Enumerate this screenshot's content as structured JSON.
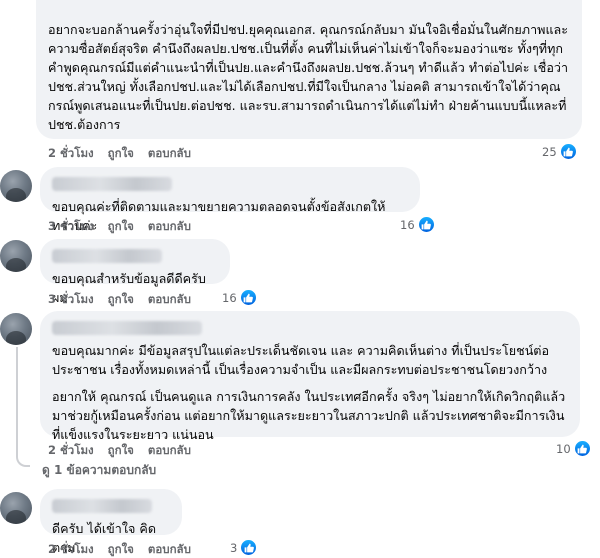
{
  "comments": [
    {
      "paragraphs": [
        "อยากจะบอกล้านครั้งว่าอุ่นใจที่มีปชป.ยุคคุณเอกส. คุณกรณ์กลับมา มันใจอิเชื่อมั่นในศักยภาพและความซื่อสัตย์สุจริต คำนึงถึงผลปย.ปชช.เป็นที่ตั้ง คนที่ไม่เห็นค่าไม่เข้าใจก็จะมองว่าแซะ ทั้งๆที่ทุกคำพูดคุณกรณ์มีแต่คำแนะนำที่เป็นปย.และคำนึงถึงผลปย.ปชช.ล้วนๆ ทำดีแล้ว ทำต่อไปค่ะ เชื่อว่าปชช.ส่วนใหญ่ ทั้งเลือกปชป.และไม่ได้เลือกปชป.ที่มีใจเป็นกลาง ไม่อคติ สามารถเข้าใจได้ว่าคุณกรณ์พูดเสนอแนะที่เป็นปย.ต่อปชช. และรบ.สามารถดำเนินการได้แต่ไม่ทำ ฝ่ายค้านแบบนี้แหละที่ปชช.ต้องการ"
      ],
      "time": "2 ชั่วโมง",
      "like_label": "ถูกใจ",
      "reply_label": "ตอบกลับ",
      "reaction_count": "25"
    },
    {
      "paragraphs": [
        "ขอบคุณค่ะที่ติดตามและมาขยายความตลอดจนตั้งข้อสังเกตให้ทราบค่ะ"
      ],
      "time": "3 ชั่วโมง",
      "like_label": "ถูกใจ",
      "reply_label": "ตอบกลับ",
      "reaction_count": "16"
    },
    {
      "paragraphs": [
        "ขอบคุณสำหรับข้อมูลดีดีครับผม"
      ],
      "time": "3 ชั่วโมง",
      "like_label": "ถูกใจ",
      "reply_label": "ตอบกลับ",
      "reaction_count": "16"
    },
    {
      "paragraphs": [
        "ขอบคุณมากค่ะ มีข้อมูลสรุปในแต่ละประเด็นชัดเจน และ ความคิดเห็นต่าง ที่เป็นประโยชน์ต่อประชาชน เรื่องทั้งหมดเหล่านี้ เป็นเรื่องความจำเป็น และมีผลกระทบต่อประชาชนโดยวงกว้าง",
        "อยากให้ คุณกรณ์ เป็นคนดูแล การเงินการคลัง ในประเทศอีกครั้ง จริงๆ ไม่อยากให้เกิดวิกฤติแล้วมาช่วยกู้เหมือนครั้งก่อน แต่อยากให้มาดูแลระยะยาวในสภาวะปกติ แล้วประเทศชาติจะมีการเงินที่แข็งแรงในระยะยาว แน่นอน"
      ],
      "time": "2 ชั่วโมง",
      "like_label": "ถูกใจ",
      "reply_label": "ตอบกลับ",
      "reaction_count": "10",
      "view_replies": "ดู 1 ข้อความตอบกลับ"
    },
    {
      "paragraphs": [
        "ดีครับ ได้เข้าใจ คิดตาม"
      ],
      "time": "2 ชั่วโมง",
      "like_label": "ถูกใจ",
      "reply_label": "ตอบกลับ",
      "reaction_count": "3"
    }
  ],
  "colors": {
    "bubble": "#f0f2f5",
    "meta": "#65676b",
    "like_blue": "#1877f2"
  },
  "icons": {
    "reaction": "like-thumb-icon"
  }
}
